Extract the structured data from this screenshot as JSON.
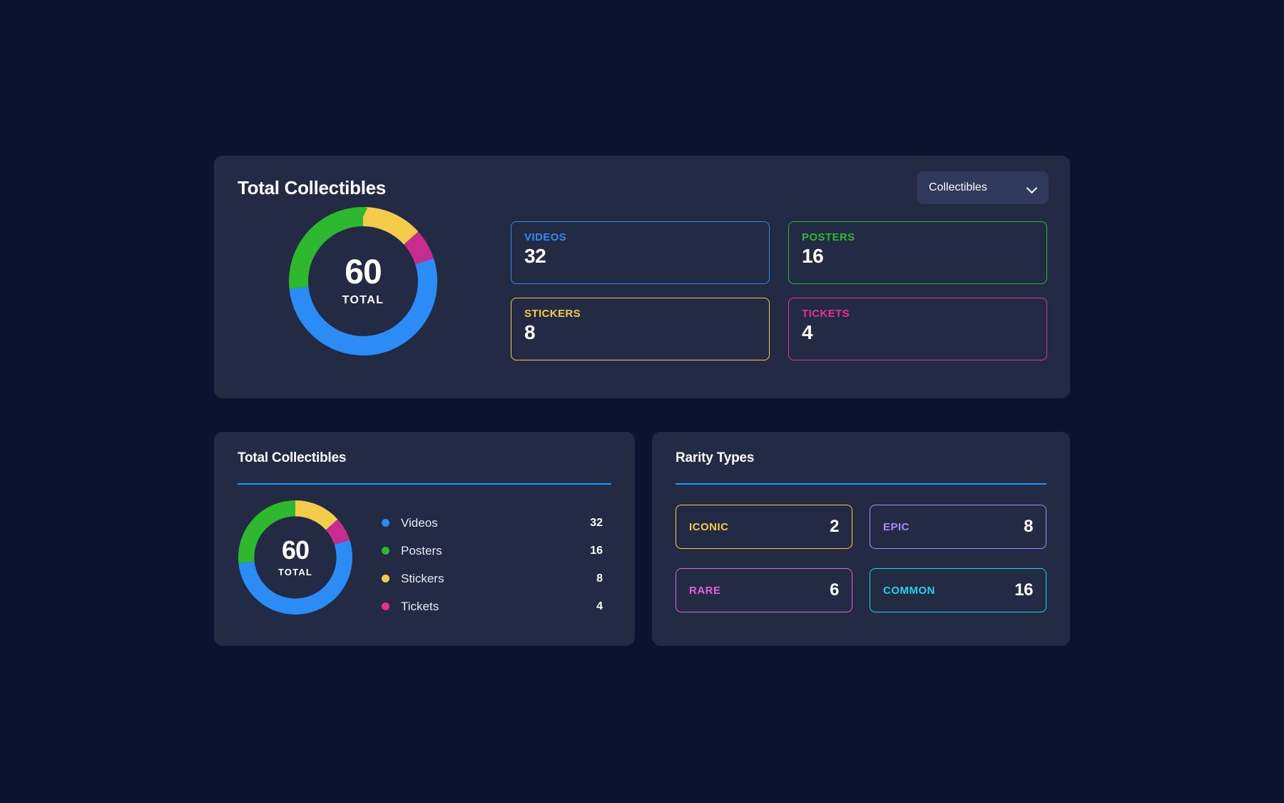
{
  "top_panel": {
    "title": "Total Collectibles",
    "dropdown": {
      "value": "Collectibles",
      "icon": "chevron-down-icon"
    },
    "donut": {
      "total": "60",
      "total_label": "TOTAL"
    },
    "stats": [
      {
        "label": "VIDEOS",
        "value": "32",
        "color": "#2b8cf5"
      },
      {
        "label": "POSTERS",
        "value": "16",
        "color": "#2eb82e"
      },
      {
        "label": "STICKERS",
        "value": "8",
        "color": "#f5cb4c"
      },
      {
        "label": "TICKETS",
        "value": "4",
        "color": "#e1338f"
      }
    ]
  },
  "bottom_left": {
    "title": "Total Collectibles",
    "divider_color": "#1f9bf0",
    "donut": {
      "total": "60",
      "total_label": "TOTAL"
    },
    "legend": [
      {
        "name": "Videos",
        "value": "32",
        "color": "#2b8cf5"
      },
      {
        "name": "Posters",
        "value": "16",
        "color": "#2eb82e"
      },
      {
        "name": "Stickers",
        "value": "8",
        "color": "#f5cb4c"
      },
      {
        "name": "Tickets",
        "value": "4",
        "color": "#e1338f"
      }
    ]
  },
  "bottom_right": {
    "title": "Rarity Types",
    "divider_color": "#1f9bf0",
    "rarities": [
      {
        "label": "ICONIC",
        "value": "2",
        "color": "#f5cb4c"
      },
      {
        "label": "EPIC",
        "value": "8",
        "color": "#a78bfa"
      },
      {
        "label": "RARE",
        "value": "6",
        "color": "#e85ddd"
      },
      {
        "label": "COMMON",
        "value": "16",
        "color": "#22d3ee"
      }
    ]
  },
  "chart_data": {
    "type": "pie",
    "title": "Total Collectibles",
    "categories": [
      "Stickers",
      "Tickets",
      "Videos",
      "Posters"
    ],
    "values": [
      8,
      4,
      32,
      16
    ],
    "colors": [
      "#f5cb4c",
      "#c72d8e",
      "#2b8cf5",
      "#2eb82e"
    ],
    "total": 60,
    "center_label": "TOTAL",
    "start_angle_deg": 0,
    "direction": "clockwise",
    "hole_ratio": 0.72,
    "legend": "right",
    "legend_entries": [
      {
        "name": "Videos",
        "value": 32
      },
      {
        "name": "Posters",
        "value": 16
      },
      {
        "name": "Stickers",
        "value": 8
      },
      {
        "name": "Tickets",
        "value": 4
      }
    ]
  }
}
